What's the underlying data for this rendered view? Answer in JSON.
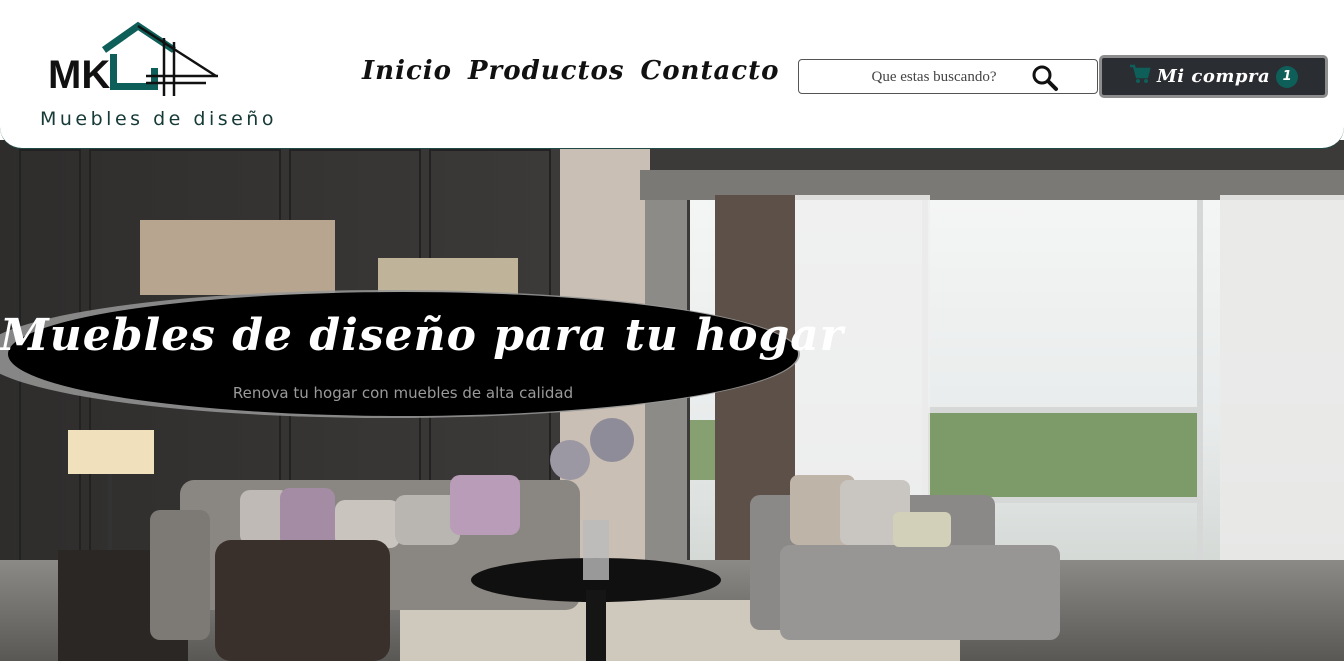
{
  "brand": {
    "logo_text": "MK",
    "tagline": "Muebles de diseño"
  },
  "nav": {
    "items": [
      "Inicio",
      "Productos",
      "Contacto"
    ]
  },
  "search": {
    "placeholder": "Que estas buscando?",
    "value": ""
  },
  "cart": {
    "label": "Mi compra",
    "count": "1",
    "icon": "cart-icon"
  },
  "hero": {
    "title": "Muebles de diseño para tu hogar",
    "subtitle": "Renova tu hogar con muebles de alta calidad"
  },
  "colors": {
    "brand_teal": "#0e5e5a",
    "dark": "#2a2d32"
  }
}
